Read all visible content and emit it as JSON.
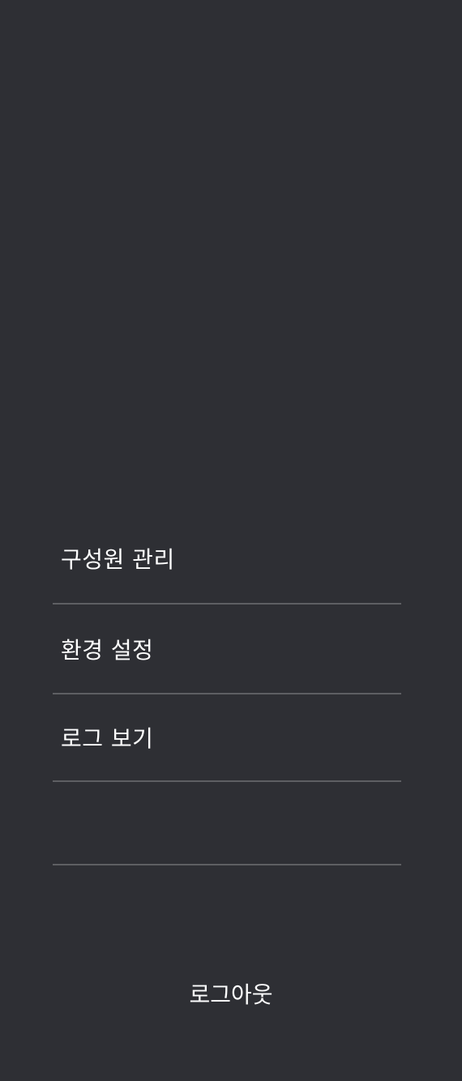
{
  "menu": {
    "items": [
      {
        "label": "구성원 관리"
      },
      {
        "label": "환경 설정"
      },
      {
        "label": "로그 보기"
      },
      {
        "label": ""
      }
    ]
  },
  "logout": {
    "label": "로그아웃"
  },
  "colors": {
    "background": "#2e2f34",
    "divider": "#5e5f63",
    "text": "#ffffff"
  }
}
